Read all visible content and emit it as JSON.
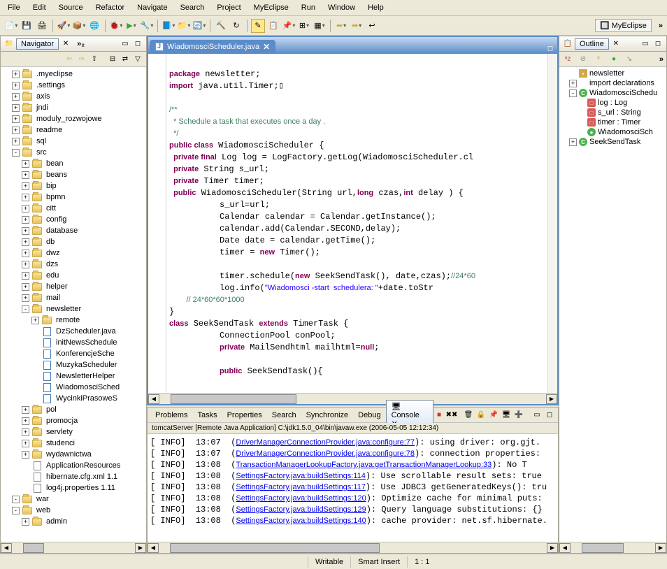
{
  "menubar": [
    "File",
    "Edit",
    "Source",
    "Refactor",
    "Navigate",
    "Search",
    "Project",
    "MyEclipse",
    "Run",
    "Window",
    "Help"
  ],
  "perspective": {
    "label": "MyEclipse"
  },
  "navigator": {
    "title": "Navigator",
    "tree": [
      {
        "d": 1,
        "e": "+",
        "t": "folder",
        "l": ".myeclipse"
      },
      {
        "d": 1,
        "e": "+",
        "t": "folder",
        "l": ".settings"
      },
      {
        "d": 1,
        "e": "+",
        "t": "folder",
        "l": "axis"
      },
      {
        "d": 1,
        "e": "+",
        "t": "folder",
        "l": "jndi"
      },
      {
        "d": 1,
        "e": "+",
        "t": "folder",
        "l": "moduly_rozwojowe"
      },
      {
        "d": 1,
        "e": "+",
        "t": "folder",
        "l": "readme"
      },
      {
        "d": 1,
        "e": "+",
        "t": "folder",
        "l": "sql"
      },
      {
        "d": 1,
        "e": "-",
        "t": "folder",
        "l": "src"
      },
      {
        "d": 2,
        "e": "+",
        "t": "folder",
        "l": "bean"
      },
      {
        "d": 2,
        "e": "+",
        "t": "folder",
        "l": "beans"
      },
      {
        "d": 2,
        "e": "+",
        "t": "folder",
        "l": "bip"
      },
      {
        "d": 2,
        "e": "+",
        "t": "folder",
        "l": "bpmn"
      },
      {
        "d": 2,
        "e": "+",
        "t": "folder",
        "l": "citt"
      },
      {
        "d": 2,
        "e": "+",
        "t": "folder",
        "l": "config"
      },
      {
        "d": 2,
        "e": "+",
        "t": "folder",
        "l": "database"
      },
      {
        "d": 2,
        "e": "+",
        "t": "folder",
        "l": "db"
      },
      {
        "d": 2,
        "e": "+",
        "t": "folder",
        "l": "dwz"
      },
      {
        "d": 2,
        "e": "+",
        "t": "folder",
        "l": "dzs"
      },
      {
        "d": 2,
        "e": "+",
        "t": "folder",
        "l": "edu"
      },
      {
        "d": 2,
        "e": "+",
        "t": "folder",
        "l": "helper"
      },
      {
        "d": 2,
        "e": "+",
        "t": "folder",
        "l": "mail"
      },
      {
        "d": 2,
        "e": "-",
        "t": "folder",
        "l": "newsletter"
      },
      {
        "d": 3,
        "e": "+",
        "t": "folder",
        "l": "remote"
      },
      {
        "d": 3,
        "e": "",
        "t": "java",
        "l": "DzScheduler.java"
      },
      {
        "d": 3,
        "e": "",
        "t": "java",
        "l": "initNewsSchedule"
      },
      {
        "d": 3,
        "e": "",
        "t": "java",
        "l": "KonferencjeSche"
      },
      {
        "d": 3,
        "e": "",
        "t": "java",
        "l": "MuzykaScheduler"
      },
      {
        "d": 3,
        "e": "",
        "t": "java",
        "l": "NewsletterHelper"
      },
      {
        "d": 3,
        "e": "",
        "t": "java",
        "l": "WiadomosciSched"
      },
      {
        "d": 3,
        "e": "",
        "t": "java",
        "l": "WycinkiPrasoweS"
      },
      {
        "d": 2,
        "e": "+",
        "t": "folder",
        "l": "pol"
      },
      {
        "d": 2,
        "e": "+",
        "t": "folder",
        "l": "promocja"
      },
      {
        "d": 2,
        "e": "+",
        "t": "folder",
        "l": "servlety"
      },
      {
        "d": 2,
        "e": "+",
        "t": "folder",
        "l": "studenci"
      },
      {
        "d": 2,
        "e": "+",
        "t": "folder",
        "l": "wydawnictwa"
      },
      {
        "d": 2,
        "e": "",
        "t": "file",
        "l": "ApplicationResources"
      },
      {
        "d": 2,
        "e": "",
        "t": "file",
        "l": "hibernate.cfg.xml 1.1"
      },
      {
        "d": 2,
        "e": "",
        "t": "file",
        "l": "log4j.properties 1.11"
      },
      {
        "d": 1,
        "e": "-",
        "t": "folder",
        "l": "war"
      },
      {
        "d": 1,
        "e": "-",
        "t": "folder",
        "l": "web"
      },
      {
        "d": 2,
        "e": "+",
        "t": "folder",
        "l": "admin"
      }
    ]
  },
  "editor": {
    "tab": "WiadomosciScheduler.java",
    "lines": [
      {
        "t": ""
      },
      {
        "t": "package",
        "s": [
          "kw",
          "",
          "pkg"
        ],
        "parts": [
          "package",
          " newsletter;"
        ]
      },
      {
        "t": "import",
        "s": [
          "kw"
        ],
        "parts": [
          "import",
          " java.util.Timer;▯"
        ]
      },
      {
        "t": ""
      },
      {
        "cmt": "/**"
      },
      {
        "cmt": "  * Schedule a task that executes once a day ."
      },
      {
        "cmt": "  */"
      },
      {
        "parts": [
          "public class",
          " WiadomosciScheduler {"
        ],
        "s": [
          "kw"
        ]
      },
      {
        "parts": [
          "  private final",
          " Log log = LogFactory.getLog(WiadomosciScheduler.cl"
        ],
        "s": [
          "kw"
        ]
      },
      {
        "parts": [
          "  private",
          " String s_url;"
        ],
        "s": [
          "kw"
        ]
      },
      {
        "parts": [
          "  private",
          " Timer timer;"
        ],
        "s": [
          "kw"
        ]
      },
      {
        "parts": [
          "  public",
          " WiadomosciScheduler(String url,",
          "long",
          " czas,",
          "int",
          " delay ) {"
        ],
        "s": [
          "kw",
          "",
          "kw",
          "",
          "kw"
        ]
      },
      {
        "t": "          s_url=url;"
      },
      {
        "t": "          Calendar calendar = Calendar.getInstance();"
      },
      {
        "t": "          calendar.add(Calendar.SECOND,delay);"
      },
      {
        "t": "          Date date = calendar.getTime();"
      },
      {
        "parts": [
          "          timer = ",
          "new",
          " Timer();"
        ],
        "s": [
          "",
          "kw"
        ]
      },
      {
        "t": ""
      },
      {
        "parts": [
          "          timer.schedule(",
          "new",
          " SeekSendTask(), date,czas);",
          "//24*60"
        ],
        "s": [
          "",
          "kw",
          "",
          "cmt"
        ]
      },
      {
        "parts": [
          "          log.info(",
          "\"Wiadomosci -start  schedulera: \"",
          "+date.toStr"
        ],
        "s": [
          "",
          "str"
        ]
      },
      {
        "cmt": "        // 24*60*60*1000"
      },
      {
        "t": "}"
      },
      {
        "parts": [
          "class",
          " SeekSendTask ",
          "extends",
          " TimerTask {"
        ],
        "s": [
          "kw",
          "",
          "kw"
        ]
      },
      {
        "t": "          ConnectionPool conPool;"
      },
      {
        "parts": [
          "          ",
          "private",
          " MailSendhtml mailhtml=",
          "null",
          ";"
        ],
        "s": [
          "",
          "kw",
          "",
          "kw"
        ]
      },
      {
        "t": ""
      },
      {
        "parts": [
          "          ",
          "public",
          " SeekSendTask(){"
        ],
        "s": [
          "",
          "kw"
        ]
      }
    ]
  },
  "console": {
    "tabs": [
      "Problems",
      "Tasks",
      "Properties",
      "Search",
      "Synchronize",
      "Debug",
      "Console"
    ],
    "active": "Console",
    "subtitle": "tomcatServer [Remote Java Application] C:\\jdk1.5.0_04\\bin\\javaw.exe (2006-05-05 12:12:34)",
    "lines": [
      {
        "p": "[ INFO]  13:07  (",
        "l": "DriverManagerConnectionProvider.java:configure:77",
        "r": "): using driver: org.gjt."
      },
      {
        "p": "[ INFO]  13:07  (",
        "l": "DriverManagerConnectionProvider.java:configure:78",
        "r": "): connection properties:"
      },
      {
        "p": "[ INFO]  13:08  (",
        "l": "TransactionManagerLookupFactory.java:getTransactionManagerLookup:33",
        "r": "): No T"
      },
      {
        "p": "[ INFO]  13:08  (",
        "l": "SettingsFactory.java:buildSettings:114",
        "r": "): Use scrollable result sets: true"
      },
      {
        "p": "[ INFO]  13:08  (",
        "l": "SettingsFactory.java:buildSettings:117",
        "r": "): Use JDBC3 getGeneratedKeys(): tru"
      },
      {
        "p": "[ INFO]  13:08  (",
        "l": "SettingsFactory.java:buildSettings:120",
        "r": "): Optimize cache for minimal puts:"
      },
      {
        "p": "[ INFO]  13:08  (",
        "l": "SettingsFactory.java:buildSettings:129",
        "r": "): Query language substitutions: {}"
      },
      {
        "p": "[ INFO]  13:08  (",
        "l": "SettingsFactory.java:buildSettings:140",
        "r": "): cache provider: net.sf.hibernate."
      }
    ]
  },
  "outline": {
    "title": "Outline",
    "items": [
      {
        "d": 1,
        "i": "pkg",
        "l": "newsletter"
      },
      {
        "d": 1,
        "i": "imp",
        "l": "import declarations",
        "e": "+"
      },
      {
        "d": 1,
        "i": "cls",
        "l": "WiadomosciSchedu",
        "e": "-"
      },
      {
        "d": 2,
        "i": "fld",
        "l": "log : Log"
      },
      {
        "d": 2,
        "i": "fld",
        "l": "s_url : String"
      },
      {
        "d": 2,
        "i": "fld",
        "l": "timer : Timer"
      },
      {
        "d": 2,
        "i": "mtd",
        "l": "WiadomosciSch"
      },
      {
        "d": 1,
        "i": "cls",
        "l": "SeekSendTask",
        "e": "+"
      }
    ]
  },
  "statusbar": {
    "writable": "Writable",
    "insert": "Smart Insert",
    "pos": "1 : 1"
  }
}
